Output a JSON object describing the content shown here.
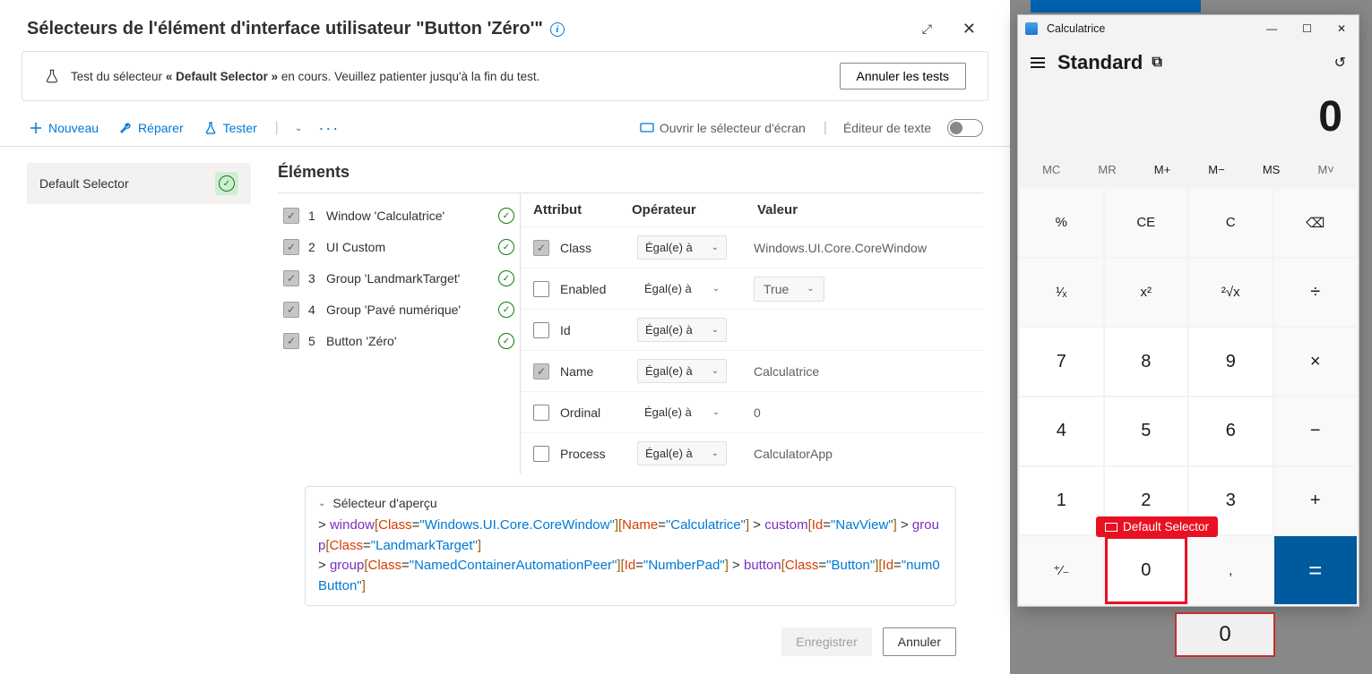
{
  "dialog": {
    "title": "Sélecteurs de l'élément d'interface utilisateur \"Button 'Zéro'\"",
    "banner": {
      "prefix": "Test du sélecteur ",
      "bold": "« Default Selector »",
      "suffix": " en cours. Veuillez patienter jusqu'à la fin du test.",
      "cancel": "Annuler les tests"
    },
    "toolbar": {
      "new": "Nouveau",
      "repair": "Réparer",
      "test": "Tester",
      "open_screen": "Ouvrir le sélecteur d'écran",
      "text_editor": "Éditeur de texte"
    },
    "selector_list": {
      "default": "Default Selector"
    },
    "elements_title": "Éléments",
    "elements": [
      {
        "n": "1",
        "label": "Window 'Calculatrice'"
      },
      {
        "n": "2",
        "label": "UI Custom"
      },
      {
        "n": "3",
        "label": "Group 'LandmarkTarget'"
      },
      {
        "n": "4",
        "label": "Group 'Pavé numérique'"
      },
      {
        "n": "5",
        "label": "Button 'Zéro'"
      }
    ],
    "attr_headers": {
      "a": "Attribut",
      "o": "Opérateur",
      "v": "Valeur"
    },
    "attrs": [
      {
        "cb": true,
        "name": "Class",
        "op": "Égal(e) à",
        "op_box": true,
        "val": "Windows.UI.Core.CoreWindow"
      },
      {
        "cb": false,
        "name": "Enabled",
        "op": "Égal(e) à",
        "op_box": false,
        "val": "True",
        "val_sel": true
      },
      {
        "cb": false,
        "name": "Id",
        "op": "Égal(e) à",
        "op_box": true,
        "val": ""
      },
      {
        "cb": true,
        "name": "Name",
        "op": "Égal(e) à",
        "op_box": true,
        "val": "Calculatrice"
      },
      {
        "cb": false,
        "name": "Ordinal",
        "op": "Égal(e) à",
        "op_box": false,
        "val": "0"
      },
      {
        "cb": false,
        "name": "Process",
        "op": "Égal(e) à",
        "op_box": true,
        "val": "CalculatorApp"
      }
    ],
    "preview_title": "Sélecteur d'aperçu",
    "footer": {
      "save": "Enregistrer",
      "cancel": "Annuler"
    }
  },
  "badge": "Default Selector",
  "calc": {
    "title": "Calculatrice",
    "mode": "Standard",
    "display": "0",
    "mem": [
      "MC",
      "MR",
      "M+",
      "M−",
      "MS",
      "M˅"
    ],
    "buttons": {
      "pct": "%",
      "ce": "CE",
      "c": "C",
      "back": "⌫",
      "inv": "¹⁄ₓ",
      "sq": "x²",
      "sqrt": "²√x",
      "div": "÷",
      "n7": "7",
      "n8": "8",
      "n9": "9",
      "mul": "×",
      "n4": "4",
      "n5": "5",
      "n6": "6",
      "sub": "−",
      "n1": "1",
      "n2": "2",
      "n3": "3",
      "add": "+",
      "pm": "⁺⁄₋",
      "n0": "0",
      "dot": ",",
      "eq": "="
    }
  },
  "extra_zero": "0"
}
